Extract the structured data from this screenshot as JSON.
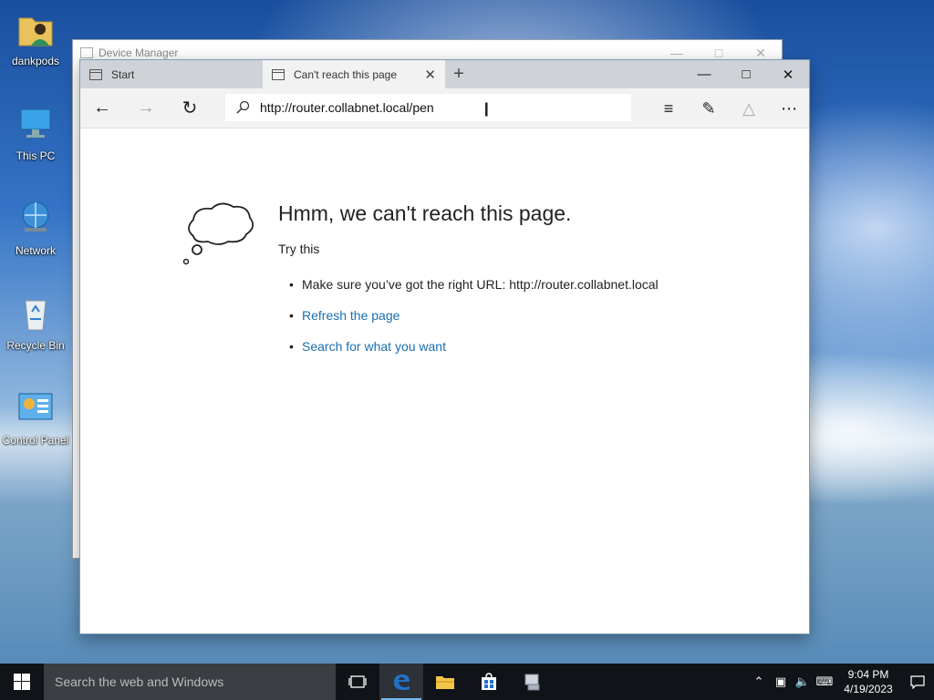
{
  "desktop": {
    "icons": [
      {
        "label": "dankpods",
        "icon": "user-folder-icon"
      },
      {
        "label": "This PC",
        "icon": "computer-icon"
      },
      {
        "label": "Network",
        "icon": "network-icon"
      },
      {
        "label": "Recycle Bin",
        "icon": "recycle-bin-icon"
      },
      {
        "label": "Control Panel",
        "icon": "control-panel-icon"
      }
    ]
  },
  "background_window": {
    "title": "Device Manager"
  },
  "browser": {
    "tabs": [
      {
        "label": "Start",
        "active": false
      },
      {
        "label": "Can't reach this page",
        "active": true
      }
    ],
    "address": "http://router.collabnet.local/pen",
    "page": {
      "title": "Hmm, we can't reach this page.",
      "subtitle": "Try this",
      "tips": [
        {
          "text": "Make sure you’ve got the right URL: http://router.collabnet.local",
          "link": false
        },
        {
          "text": "Refresh the page",
          "link": true
        },
        {
          "text": "Search for what you want",
          "link": true
        }
      ]
    }
  },
  "taskbar": {
    "search_placeholder": "Search the web and Windows",
    "time": "9:04 PM",
    "date": "4/19/2023"
  },
  "colors": {
    "link": "#1a6fb0",
    "taskbar": "#101418",
    "edge_blue": "#1e73c8"
  }
}
